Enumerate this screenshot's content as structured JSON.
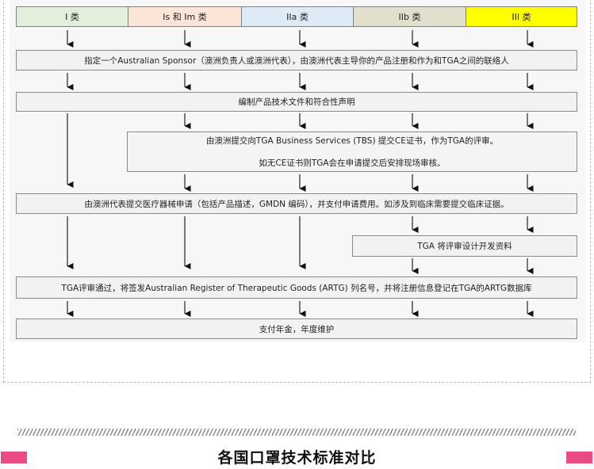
{
  "diagram": {
    "class_headers": [
      {
        "label": "I 类",
        "color": "#e2efda"
      },
      {
        "label": "Is 和 Im 类",
        "color": "#fce4d6"
      },
      {
        "label": "IIa 类",
        "color": "#ddebf7"
      },
      {
        "label": "IIb 类",
        "color": "#e2e0cc"
      },
      {
        "label": "III 类",
        "color": "#ffff00"
      }
    ],
    "steps": {
      "sponsor": "指定一个Australian Sponsor（澳洲负责人或澳洲代表），由澳洲代表主导你的产品注册和作为和TGA之间的联络人",
      "tech_file": "编制产品技术文件和符合性声明",
      "tga_business_line1": "由澳洲提交向TGA Business Services (TBS) 提交CE证书，作为TGA的评审。",
      "tga_business_line2": "如无CE证书则TGA会在申请提交后安排现场审核。",
      "application": "由澳洲代表提交医疗器械申请（包括产品描述，GMDN 编码），并支付申请费用。如涉及到临床需要提交临床证据。",
      "design_review": "TGA 将评审设计开发资料",
      "artg": "TGA评审通过，将签发Australian Register of Therapeutic Goods (ARTG) 列名号，并将注册信息登记在TGA的ARTG数据库",
      "annual_fee": "支付年金，年度维护"
    }
  },
  "section": {
    "title": "各国口罩技术标准对比",
    "accent_color": "#e94b84"
  }
}
